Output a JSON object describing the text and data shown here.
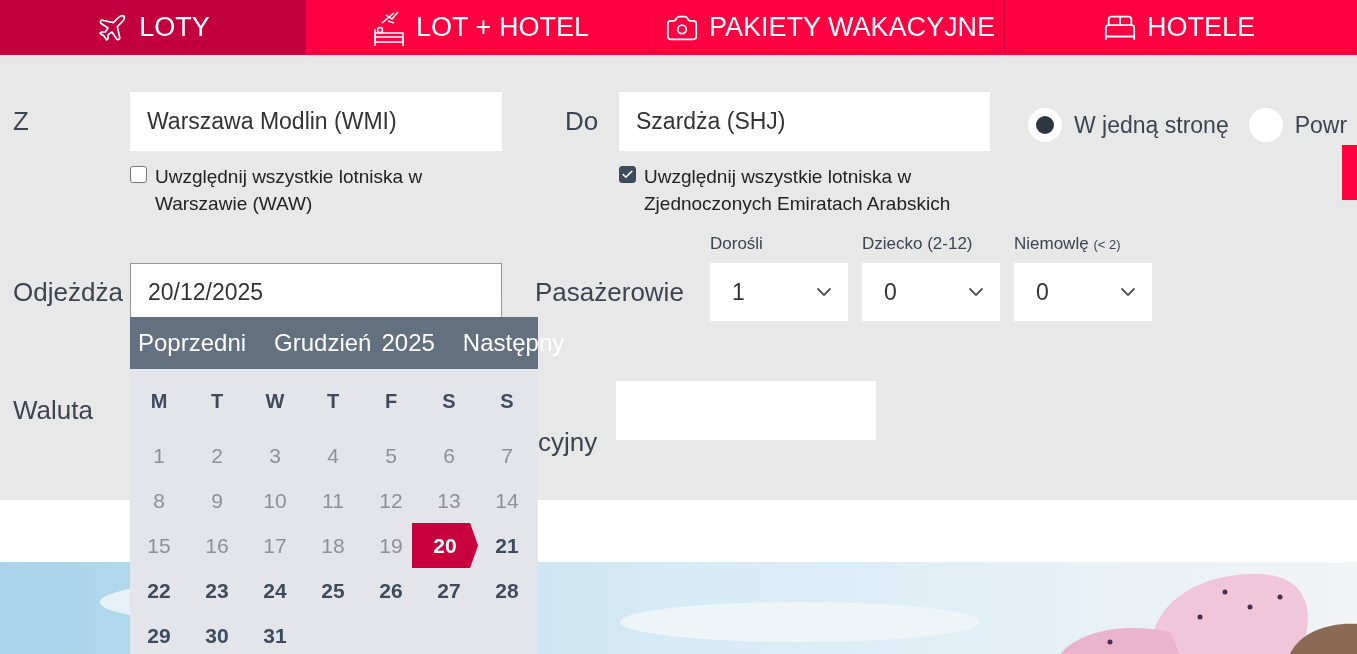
{
  "tabs": [
    {
      "label": "LOTY",
      "kind": "plane",
      "selected": true
    },
    {
      "label": "LOT + HOTEL",
      "kind": "plane-bed",
      "selected": false
    },
    {
      "label": "PAKIETY WAKACYJNE",
      "kind": "camera",
      "selected": false
    },
    {
      "label": "HOTELE",
      "kind": "bed",
      "selected": false
    }
  ],
  "from": {
    "label": "Z",
    "value": "Warszawa Modlin (WMI)",
    "option": {
      "label": "Uwzględnij wszystkie lotniska w Warszawie (WAW)",
      "checked": false
    }
  },
  "to": {
    "label": "Do",
    "value": "Szardża (SHJ)",
    "option": {
      "label": "Uwzględnij wszystkie lotniska w Zjednoczonych Emiratach Arabskich",
      "checked": true
    }
  },
  "trip_type": [
    {
      "label": "W jedną stronę",
      "selected": true
    },
    {
      "label": "Powr",
      "selected": false
    }
  ],
  "departure": {
    "label": "Odjeżdża",
    "value": "20/12/2025"
  },
  "passengers": {
    "label": "Pasażerowie",
    "groups": [
      {
        "label": "Dorośli",
        "value": "1"
      },
      {
        "label": "Dziecko (2-12)",
        "value": "0"
      },
      {
        "label": "Niemowlę",
        "note": "(< 2)",
        "value": "0"
      }
    ]
  },
  "currency": {
    "label": "Waluta"
  },
  "promo": {
    "label": "cyjny"
  },
  "calendar": {
    "prev": "Poprzedni",
    "month": "Grudzień",
    "year": "2025",
    "next": "Następny",
    "weekdays": [
      "M",
      "T",
      "W",
      "T",
      "F",
      "S",
      "S"
    ],
    "days": [
      {
        "label": "1",
        "disabled": true,
        "selected": false
      },
      {
        "label": "2",
        "disabled": true,
        "selected": false
      },
      {
        "label": "3",
        "disabled": true,
        "selected": false
      },
      {
        "label": "4",
        "disabled": true,
        "selected": false
      },
      {
        "label": "5",
        "disabled": true,
        "selected": false
      },
      {
        "label": "6",
        "disabled": true,
        "selected": false
      },
      {
        "label": "7",
        "disabled": true,
        "selected": false
      },
      {
        "label": "8",
        "disabled": true,
        "selected": false
      },
      {
        "label": "9",
        "disabled": true,
        "selected": false
      },
      {
        "label": "10",
        "disabled": true,
        "selected": false
      },
      {
        "label": "11",
        "disabled": true,
        "selected": false
      },
      {
        "label": "12",
        "disabled": true,
        "selected": false
      },
      {
        "label": "13",
        "disabled": true,
        "selected": false
      },
      {
        "label": "14",
        "disabled": true,
        "selected": false
      },
      {
        "label": "15",
        "disabled": true,
        "selected": false
      },
      {
        "label": "16",
        "disabled": true,
        "selected": false
      },
      {
        "label": "17",
        "disabled": true,
        "selected": false
      },
      {
        "label": "18",
        "disabled": true,
        "selected": false
      },
      {
        "label": "19",
        "disabled": true,
        "selected": false
      },
      {
        "label": "20",
        "disabled": false,
        "selected": true
      },
      {
        "label": "21",
        "disabled": false,
        "selected": false
      },
      {
        "label": "22",
        "disabled": false,
        "selected": false
      },
      {
        "label": "23",
        "disabled": false,
        "selected": false
      },
      {
        "label": "24",
        "disabled": false,
        "selected": false
      },
      {
        "label": "25",
        "disabled": false,
        "selected": false
      },
      {
        "label": "26",
        "disabled": false,
        "selected": false
      },
      {
        "label": "27",
        "disabled": false,
        "selected": false
      },
      {
        "label": "28",
        "disabled": false,
        "selected": false
      },
      {
        "label": "29",
        "disabled": false,
        "selected": false
      },
      {
        "label": "30",
        "disabled": false,
        "selected": false
      },
      {
        "label": "31",
        "disabled": false,
        "selected": false
      }
    ]
  }
}
